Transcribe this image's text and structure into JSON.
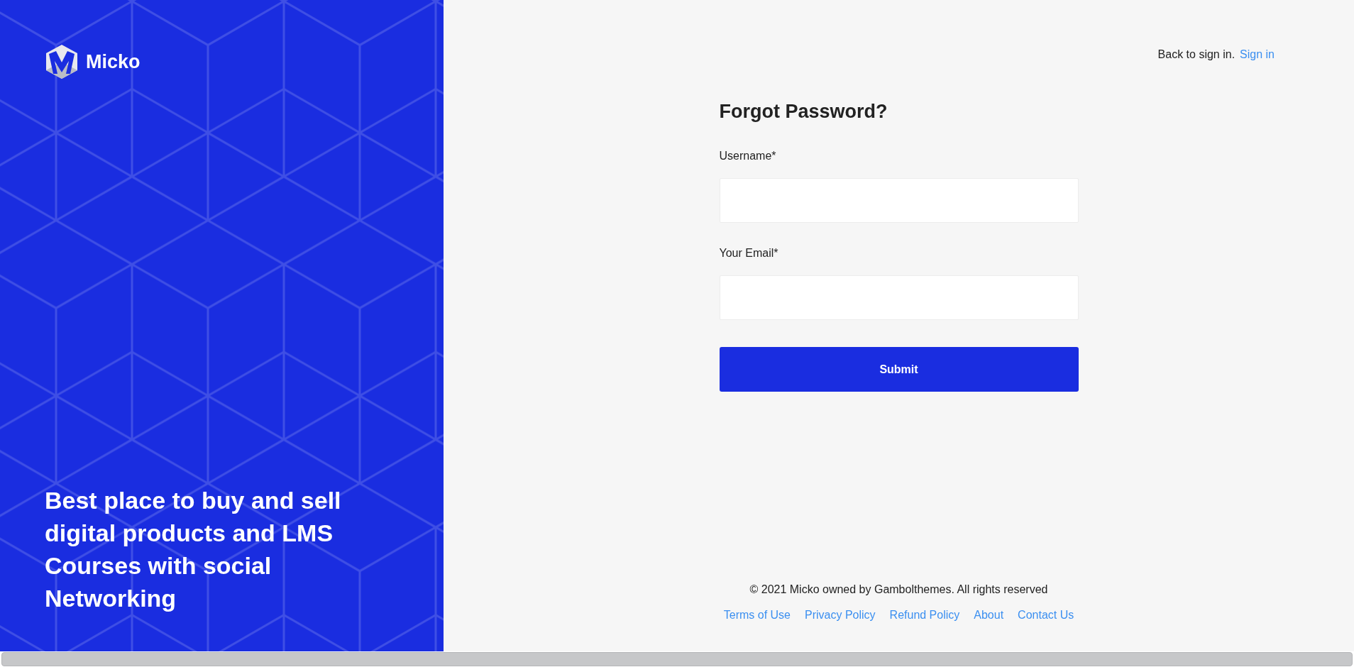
{
  "brand": {
    "name": "Micko"
  },
  "tagline": "Best place to buy and sell digital products and LMS Courses with social Networking",
  "header": {
    "prompt": "Back to sign in.",
    "link": "Sign in"
  },
  "form": {
    "title": "Forgot Password?",
    "fields": [
      {
        "label": "Username*"
      },
      {
        "label": "Your Email*"
      }
    ],
    "submit": "Submit"
  },
  "footer": {
    "copyright": "© 2021 Micko owned by Gambolthemes. All rights reserved",
    "links": [
      "Terms of Use",
      "Privacy Policy",
      "Refund Policy",
      "About",
      "Contact Us"
    ]
  }
}
